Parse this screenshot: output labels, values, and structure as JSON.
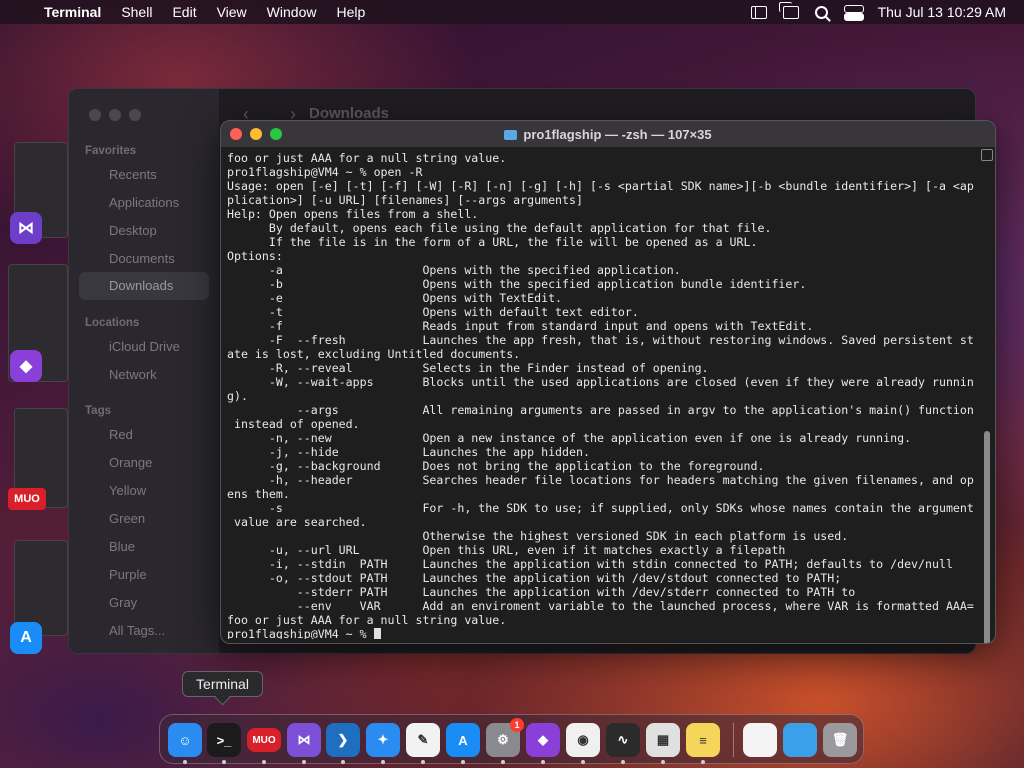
{
  "menubar": {
    "app": "Terminal",
    "items": [
      "Shell",
      "Edit",
      "View",
      "Window",
      "Help"
    ],
    "clock": "Thu Jul 13  10:29 AM"
  },
  "finder": {
    "title": "Downloads",
    "nav": "‹ ›",
    "favorites_label": "Favorites",
    "favorites": [
      "Recents",
      "Applications",
      "Desktop",
      "Documents",
      "Downloads"
    ],
    "locations_label": "Locations",
    "locations": [
      "iCloud Drive",
      "Network"
    ],
    "tags_label": "Tags",
    "tags": [
      "Red",
      "Orange",
      "Yellow",
      "Green",
      "Blue",
      "Purple",
      "Gray",
      "All Tags..."
    ]
  },
  "terminal": {
    "title": "pro1flagship — -zsh — 107×35",
    "lines": [
      "foo or just AAA for a null string value.",
      "pro1flagship@VM4 ~ % open -R",
      "Usage: open [-e] [-t] [-f] [-W] [-R] [-n] [-g] [-h] [-s <partial SDK name>][-b <bundle identifier>] [-a <ap",
      "plication>] [-u URL] [filenames] [--args arguments]",
      "Help: Open opens files from a shell.",
      "      By default, opens each file using the default application for that file.",
      "      If the file is in the form of a URL, the file will be opened as a URL.",
      "Options:",
      "      -a                    Opens with the specified application.",
      "      -b                    Opens with the specified application bundle identifier.",
      "      -e                    Opens with TextEdit.",
      "      -t                    Opens with default text editor.",
      "      -f                    Reads input from standard input and opens with TextEdit.",
      "      -F  --fresh           Launches the app fresh, that is, without restoring windows. Saved persistent st",
      "ate is lost, excluding Untitled documents.",
      "      -R, --reveal          Selects in the Finder instead of opening.",
      "      -W, --wait-apps       Blocks until the used applications are closed (even if they were already runnin",
      "g).",
      "          --args            All remaining arguments are passed in argv to the application's main() function",
      " instead of opened.",
      "      -n, --new             Open a new instance of the application even if one is already running.",
      "      -j, --hide            Launches the app hidden.",
      "      -g, --background      Does not bring the application to the foreground.",
      "      -h, --header          Searches header file locations for headers matching the given filenames, and op",
      "ens them.",
      "      -s                    For -h, the SDK to use; if supplied, only SDKs whose names contain the argument",
      " value are searched.",
      "                            Otherwise the highest versioned SDK in each platform is used.",
      "      -u, --url URL         Open this URL, even if it matches exactly a filepath",
      "      -i, --stdin  PATH     Launches the application with stdin connected to PATH; defaults to /dev/null",
      "      -o, --stdout PATH     Launches the application with /dev/stdout connected to PATH;",
      "          --stderr PATH     Launches the application with /dev/stderr connected to PATH to",
      "          --env    VAR      Add an enviroment variable to the launched process, where VAR is formatted AAA=",
      "foo or just AAA for a null string value.",
      "pro1flagship@VM4 ~ % "
    ]
  },
  "tooltip": "Terminal",
  "stage": {
    "mur_label": "MUO"
  },
  "dock": {
    "items": [
      {
        "name": "finder",
        "glyph": "☺",
        "color": "#2a8cf0"
      },
      {
        "name": "terminal",
        "glyph": ">_",
        "color": "#1b1b1b"
      },
      {
        "name": "muo",
        "glyph": "MUO",
        "color": "#d8202a"
      },
      {
        "name": "visual-studio",
        "glyph": "⋈",
        "color": "#7b4fd6"
      },
      {
        "name": "vscode",
        "glyph": "❯",
        "color": "#1f6fc0"
      },
      {
        "name": "safari",
        "glyph": "✦",
        "color": "#2a8cf0"
      },
      {
        "name": "freeform",
        "glyph": "✎",
        "color": "#f2f2f2"
      },
      {
        "name": "app-store",
        "glyph": "A",
        "color": "#1a8cf5"
      },
      {
        "name": "system-settings",
        "glyph": "⚙",
        "color": "#8a8a8e"
      },
      {
        "name": "shortcuts",
        "glyph": "◆",
        "color": "#8b3fd9"
      },
      {
        "name": "chrome",
        "glyph": "◉",
        "color": "#f0f0f0"
      },
      {
        "name": "activity-monitor",
        "glyph": "∿",
        "color": "#2b2b2b"
      },
      {
        "name": "launchpad",
        "glyph": "▦",
        "color": "#e0e0e0"
      },
      {
        "name": "notes",
        "glyph": "≡",
        "color": "#f5d65a"
      },
      {
        "name": "document",
        "glyph": "",
        "color": "#f4f4f4"
      },
      {
        "name": "downloads-folder",
        "glyph": "",
        "color": "#3aa0e8"
      },
      {
        "name": "trash",
        "glyph": "🗑",
        "color": "#9a9a9e"
      }
    ],
    "badge": "1"
  }
}
